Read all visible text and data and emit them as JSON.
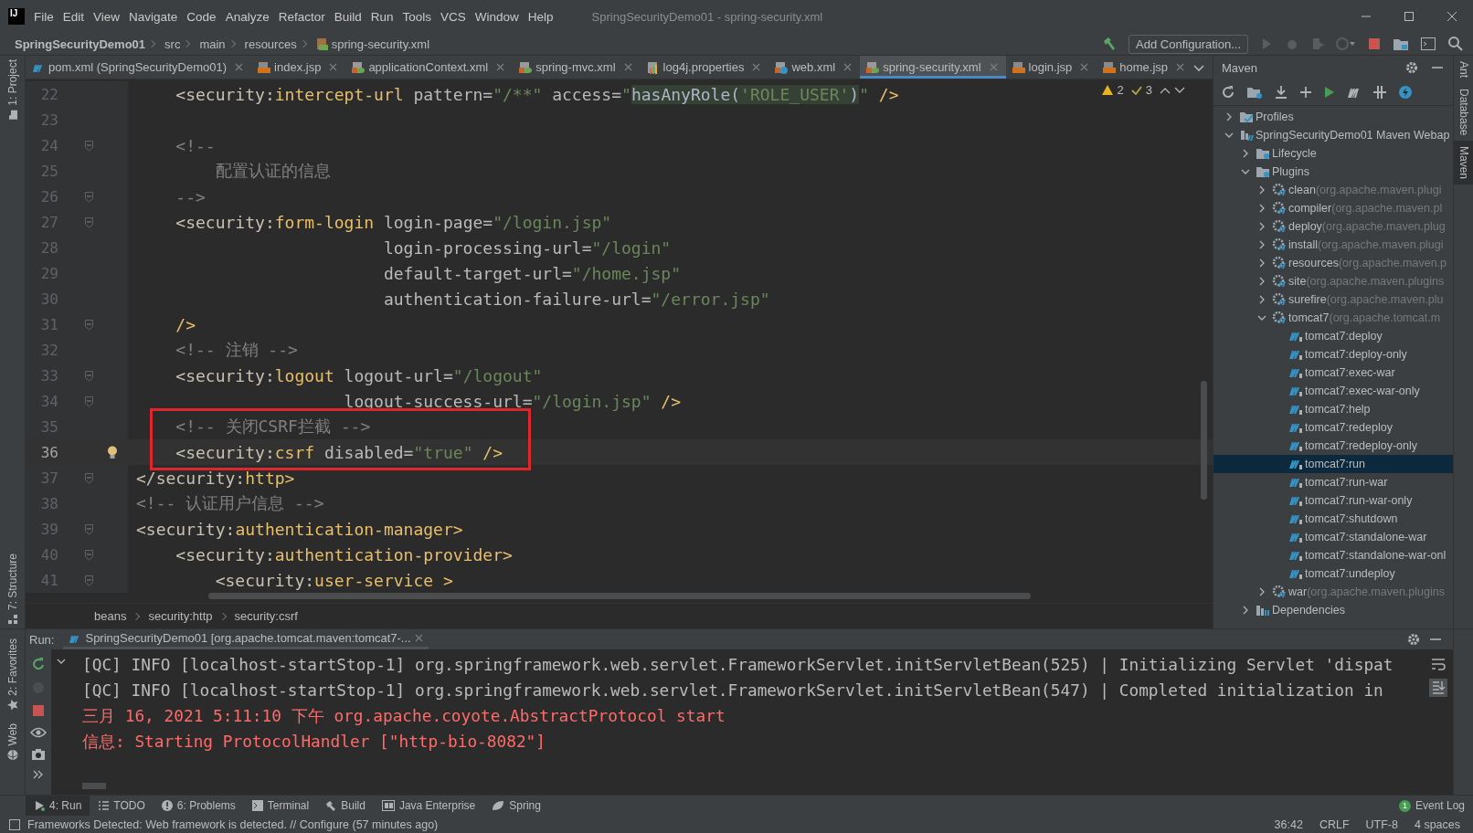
{
  "window": {
    "logo": "IJ",
    "title": "SpringSecurityDemo01 - spring-security.xml"
  },
  "menu": [
    "File",
    "Edit",
    "View",
    "Navigate",
    "Code",
    "Analyze",
    "Refactor",
    "Build",
    "Run",
    "Tools",
    "VCS",
    "Window",
    "Help"
  ],
  "nav": {
    "crumbs": [
      {
        "label": "SpringSecurityDemo01",
        "kind": "project"
      },
      {
        "label": "src",
        "kind": "folder"
      },
      {
        "label": "main",
        "kind": "folder"
      },
      {
        "label": "resources",
        "kind": "folder"
      },
      {
        "label": "spring-security.xml",
        "kind": "file"
      }
    ],
    "run_config": "Add Configuration..."
  },
  "tabs": [
    {
      "label": "pom.xml (SpringSecurityDemo01)",
      "kind": "maven",
      "selected": false
    },
    {
      "label": "index.jsp",
      "kind": "jsp",
      "selected": false
    },
    {
      "label": "applicationContext.xml",
      "kind": "spring",
      "selected": false
    },
    {
      "label": "spring-mvc.xml",
      "kind": "spring",
      "selected": false
    },
    {
      "label": "log4j.properties",
      "kind": "properties",
      "selected": false
    },
    {
      "label": "web.xml",
      "kind": "web",
      "selected": false
    },
    {
      "label": "spring-security.xml",
      "kind": "spring",
      "selected": true
    },
    {
      "label": "login.jsp",
      "kind": "jsp",
      "selected": false
    },
    {
      "label": "home.jsp",
      "kind": "jsp",
      "selected": false
    }
  ],
  "left_stripe": {
    "upper": [
      {
        "label": "1: Project",
        "kind": "project"
      },
      {
        "label": "7: Structure",
        "kind": "structure"
      }
    ],
    "lower": [
      {
        "label": "2: Favorites",
        "kind": "favorites"
      },
      {
        "label": "Web",
        "kind": "web"
      }
    ]
  },
  "right_stripe": [
    {
      "label": "Ant",
      "selected": false
    },
    {
      "label": "Database",
      "selected": false
    },
    {
      "label": "Maven",
      "selected": true
    }
  ],
  "editor": {
    "inspections": {
      "warnings": "2",
      "weak_warnings": "3"
    },
    "lines": [
      {
        "number": "22",
        "fold": false,
        "current": false,
        "boxed": false,
        "tokens": [
          {
            "kind": "ns",
            "text": "    <security:"
          },
          {
            "kind": "tag",
            "text": "intercept-url"
          },
          {
            "kind": "attr",
            "text": " pattern="
          },
          {
            "kind": "str",
            "text": "\"/**\""
          },
          {
            "kind": "attr",
            "text": " access="
          },
          {
            "kind": "str",
            "text": "\""
          },
          {
            "kind": "inj",
            "text": "hasAnyRole("
          },
          {
            "kind": "injstr",
            "text": "'ROLE_USER'"
          },
          {
            "kind": "inj",
            "text": ")"
          },
          {
            "kind": "str",
            "text": "\""
          },
          {
            "kind": "tag",
            "text": " />"
          }
        ]
      },
      {
        "number": "23",
        "fold": false,
        "current": false,
        "boxed": false
      },
      {
        "number": "24",
        "fold": true,
        "current": false,
        "boxed": false,
        "tokens": [
          {
            "kind": "comment",
            "text": "    <!--"
          }
        ]
      },
      {
        "number": "25",
        "fold": false,
        "current": false,
        "boxed": false,
        "tokens": [
          {
            "kind": "comment",
            "text": "        配置认证的信息"
          }
        ]
      },
      {
        "number": "26",
        "fold": true,
        "current": false,
        "boxed": false,
        "tokens": [
          {
            "kind": "comment",
            "text": "    -->"
          }
        ]
      },
      {
        "number": "27",
        "fold": true,
        "current": false,
        "boxed": false,
        "tokens": [
          {
            "kind": "ns",
            "text": "    <security:"
          },
          {
            "kind": "tag",
            "text": "form-login"
          },
          {
            "kind": "attr",
            "text": " login-page="
          },
          {
            "kind": "str",
            "text": "\"/login.jsp\""
          }
        ]
      },
      {
        "number": "28",
        "fold": false,
        "current": false,
        "boxed": false,
        "tokens": [
          {
            "kind": "attr",
            "text": "                         login-processing-url="
          },
          {
            "kind": "str",
            "text": "\"/login\""
          }
        ]
      },
      {
        "number": "29",
        "fold": false,
        "current": false,
        "boxed": false,
        "tokens": [
          {
            "kind": "attr",
            "text": "                         default-target-url="
          },
          {
            "kind": "str",
            "text": "\"/home.jsp\""
          }
        ]
      },
      {
        "number": "30",
        "fold": false,
        "current": false,
        "boxed": false,
        "tokens": [
          {
            "kind": "attr",
            "text": "                         authentication-failure-url="
          },
          {
            "kind": "str",
            "text": "\"/error.jsp\""
          }
        ]
      },
      {
        "number": "31",
        "fold": true,
        "current": false,
        "boxed": false,
        "tokens": [
          {
            "kind": "tag",
            "text": "    />"
          }
        ]
      },
      {
        "number": "32",
        "fold": false,
        "current": false,
        "boxed": false,
        "tokens": [
          {
            "kind": "comment",
            "text": "    <!-- 注销 -->"
          }
        ]
      },
      {
        "number": "33",
        "fold": true,
        "current": false,
        "boxed": false,
        "tokens": [
          {
            "kind": "ns",
            "text": "    <security:"
          },
          {
            "kind": "tag",
            "text": "logout"
          },
          {
            "kind": "attr",
            "text": " logout-url="
          },
          {
            "kind": "str",
            "text": "\"/logout\""
          }
        ]
      },
      {
        "number": "34",
        "fold": true,
        "current": false,
        "boxed": false,
        "tokens": [
          {
            "kind": "attr",
            "text": "                     logout-success-url="
          },
          {
            "kind": "str",
            "text": "\"/login.jsp\""
          },
          {
            "kind": "tag",
            "text": " />"
          }
        ]
      },
      {
        "number": "35",
        "fold": false,
        "current": false,
        "boxed": true,
        "tokens": [
          {
            "kind": "comment",
            "text": "    <!-- 关闭CSRF拦截 -->"
          }
        ]
      },
      {
        "number": "36",
        "fold": false,
        "current": true,
        "boxed": true,
        "tokens": [
          {
            "kind": "ns",
            "text": "    <security:"
          },
          {
            "kind": "tag",
            "text": "csrf"
          },
          {
            "kind": "attr",
            "text": " disabled="
          },
          {
            "kind": "str",
            "text": "\"true\""
          },
          {
            "kind": "tag",
            "text": " />"
          }
        ]
      },
      {
        "number": "37",
        "fold": true,
        "current": false,
        "boxed": false,
        "tokens": [
          {
            "kind": "ns",
            "text": "</security:"
          },
          {
            "kind": "tag",
            "text": "http>"
          }
        ]
      },
      {
        "number": "38",
        "fold": false,
        "current": false,
        "boxed": false,
        "tokens": [
          {
            "kind": "comment",
            "text": "<!-- 认证用户信息 -->"
          }
        ]
      },
      {
        "number": "39",
        "fold": true,
        "current": false,
        "boxed": false,
        "tokens": [
          {
            "kind": "ns",
            "text": "<security:"
          },
          {
            "kind": "tag",
            "text": "authentication-manager>"
          }
        ]
      },
      {
        "number": "40",
        "fold": true,
        "current": false,
        "boxed": false,
        "tokens": [
          {
            "kind": "ns",
            "text": "    <security:"
          },
          {
            "kind": "tag",
            "text": "authentication-provider>"
          }
        ]
      },
      {
        "number": "41",
        "fold": true,
        "current": false,
        "boxed": false,
        "tokens": [
          {
            "kind": "ns",
            "text": "        <security:"
          },
          {
            "kind": "tag",
            "text": "user-service >"
          }
        ]
      }
    ],
    "breadcrumbs": [
      "beans",
      "security:http",
      "security:csrf"
    ]
  },
  "maven": {
    "title": "Maven",
    "tree": [
      {
        "label": "Profiles",
        "kind": "profiles",
        "expanded": false,
        "selected": false
      },
      {
        "label": "SpringSecurityDemo01 Maven Webap",
        "kind": "project",
        "expanded": true,
        "selected": false,
        "children": [
          {
            "label": "Lifecycle",
            "kind": "folder",
            "expanded": false,
            "selected": false
          },
          {
            "label": "Plugins",
            "kind": "folder",
            "expanded": true,
            "selected": false,
            "children": [
              {
                "label": "clean",
                "detail": "(org.apache.maven.plugi",
                "kind": "plugin",
                "expanded": false,
                "selected": false
              },
              {
                "label": "compiler",
                "detail": "(org.apache.maven.pl",
                "kind": "plugin",
                "expanded": false,
                "selected": false
              },
              {
                "label": "deploy",
                "detail": "(org.apache.maven.plug",
                "kind": "plugin",
                "expanded": false,
                "selected": false
              },
              {
                "label": "install",
                "detail": "(org.apache.maven.plugi",
                "kind": "plugin",
                "expanded": false,
                "selected": false
              },
              {
                "label": "resources",
                "detail": "(org.apache.maven.p",
                "kind": "plugin",
                "expanded": false,
                "selected": false
              },
              {
                "label": "site",
                "detail": "(org.apache.maven.plugins",
                "kind": "plugin",
                "expanded": false,
                "selected": false
              },
              {
                "label": "surefire",
                "detail": "(org.apache.maven.plu",
                "kind": "plugin",
                "expanded": false,
                "selected": false
              },
              {
                "label": "tomcat7",
                "detail": "(org.apache.tomcat.m",
                "kind": "plugin",
                "expanded": true,
                "selected": false,
                "children": [
                  {
                    "label": "tomcat7:deploy",
                    "kind": "goal",
                    "selected": false
                  },
                  {
                    "label": "tomcat7:deploy-only",
                    "kind": "goal",
                    "selected": false
                  },
                  {
                    "label": "tomcat7:exec-war",
                    "kind": "goal",
                    "selected": false
                  },
                  {
                    "label": "tomcat7:exec-war-only",
                    "kind": "goal",
                    "selected": false
                  },
                  {
                    "label": "tomcat7:help",
                    "kind": "goal",
                    "selected": false
                  },
                  {
                    "label": "tomcat7:redeploy",
                    "kind": "goal",
                    "selected": false
                  },
                  {
                    "label": "tomcat7:redeploy-only",
                    "kind": "goal",
                    "selected": false
                  },
                  {
                    "label": "tomcat7:run",
                    "kind": "goal",
                    "selected": true
                  },
                  {
                    "label": "tomcat7:run-war",
                    "kind": "goal",
                    "selected": false
                  },
                  {
                    "label": "tomcat7:run-war-only",
                    "kind": "goal",
                    "selected": false
                  },
                  {
                    "label": "tomcat7:shutdown",
                    "kind": "goal",
                    "selected": false
                  },
                  {
                    "label": "tomcat7:standalone-war",
                    "kind": "goal",
                    "selected": false
                  },
                  {
                    "label": "tomcat7:standalone-war-onl",
                    "kind": "goal",
                    "selected": false
                  },
                  {
                    "label": "tomcat7:undeploy",
                    "kind": "goal",
                    "selected": false
                  }
                ]
              },
              {
                "label": "war",
                "detail": "(org.apache.maven.plugins",
                "kind": "plugin",
                "expanded": false,
                "selected": false
              }
            ]
          },
          {
            "label": "Dependencies",
            "kind": "dependencies",
            "expanded": false,
            "selected": false
          }
        ]
      }
    ]
  },
  "run": {
    "label": "Run:",
    "tab": "SpringSecurityDemo01 [org.apache.tomcat.maven:tomcat7-...",
    "console": [
      {
        "kind": "stdout",
        "text": "[QC] INFO [localhost-startStop-1] org.springframework.web.servlet.FrameworkServlet.initServletBean(525) | Initializing Servlet 'dispat"
      },
      {
        "kind": "stdout",
        "text": "[QC] INFO [localhost-startStop-1] org.springframework.web.servlet.FrameworkServlet.initServletBean(547) | Completed initialization in"
      },
      {
        "kind": "stderr",
        "text": "三月 16, 2021 5:11:10 下午 org.apache.coyote.AbstractProtocol start"
      },
      {
        "kind": "stderr",
        "text": "信息: Starting ProtocolHandler [\"http-bio-8082\"]"
      }
    ]
  },
  "toolbar": [
    {
      "label": "4: Run",
      "kind": "run",
      "selected": true
    },
    {
      "label": "TODO",
      "kind": "todo",
      "selected": false
    },
    {
      "label": "6: Problems",
      "kind": "problems",
      "selected": false
    },
    {
      "label": "Terminal",
      "kind": "terminal",
      "selected": false
    },
    {
      "label": "Build",
      "kind": "build",
      "selected": false
    },
    {
      "label": "Java Enterprise",
      "kind": "javaee",
      "selected": false
    },
    {
      "label": "Spring",
      "kind": "spring",
      "selected": false
    }
  ],
  "event_log": {
    "label": "Event Log",
    "count": "1"
  },
  "status": {
    "message": "Frameworks Detected: Web framework is detected. // Configure (57 minutes ago)",
    "items": [
      "36:42",
      "CRLF",
      "UTF-8",
      "4 spaces"
    ]
  }
}
